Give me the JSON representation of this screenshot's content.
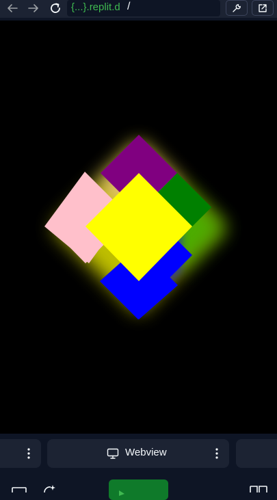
{
  "browser": {
    "url_host": "{...}.replit.d",
    "url_path": "/",
    "icons": {
      "back": "arrow-left-icon",
      "forward": "arrow-right-icon",
      "reload": "reload-icon",
      "url_forward": "arrow-right-icon",
      "devtools": "wrench-icon",
      "open_external": "external-link-icon"
    }
  },
  "scene": {
    "background": "#000000",
    "tiles": [
      {
        "name": "purple-tile",
        "color": "#800080"
      },
      {
        "name": "green-tile",
        "color": "#008000"
      },
      {
        "name": "pink-tile",
        "color": "#ffc0cb"
      },
      {
        "name": "blue-tile",
        "color": "#0000ff"
      },
      {
        "name": "yellow-tile",
        "color": "#ffff00"
      }
    ],
    "glow_color": "#ffff00"
  },
  "bottom_tabs": {
    "active": {
      "label": "Webview",
      "icon": "monitor-icon"
    }
  },
  "toolbar": {
    "run_button_color": "#0f7a2a",
    "icons": [
      "console-icon",
      "ai-sparkle-icon",
      "play-icon",
      "layout-icon"
    ]
  },
  "colors": {
    "chrome_bg": "#1c2333",
    "page_bg": "#0e1525",
    "url_host": "#3fb950",
    "text": "#f5f9fc"
  }
}
